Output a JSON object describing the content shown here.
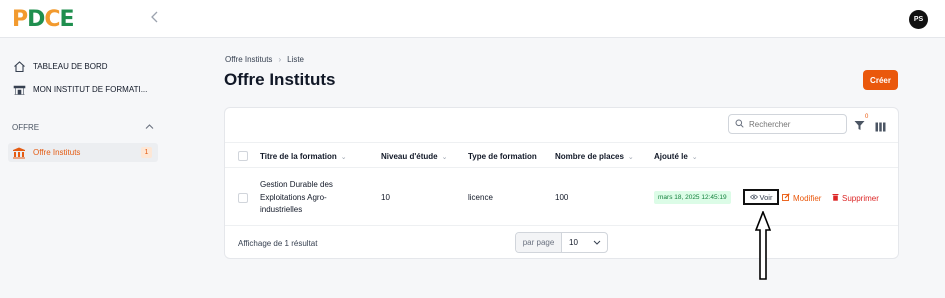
{
  "header": {
    "logo": [
      "P",
      "D",
      "C",
      "E"
    ],
    "collapse_icon": "chevron-left-icon",
    "avatar_initials": "PS"
  },
  "sidebar": {
    "items": [
      {
        "label": "TABLEAU DE BORD",
        "icon": "home-icon"
      },
      {
        "label": "MON INSTITUT DE FORMATI...",
        "icon": "building-icon"
      }
    ],
    "section_label": "OFFRE",
    "active_item": {
      "label": "Offre Instituts",
      "count": "1",
      "icon": "institution-icon"
    }
  },
  "breadcrumb": {
    "items": [
      "Offre Instituts",
      "Liste"
    ]
  },
  "page": {
    "title": "Offre Instituts",
    "create_label": "Créer"
  },
  "toolbar": {
    "search_placeholder": "Rechercher",
    "filter_count": "0"
  },
  "table": {
    "columns": [
      "Titre de la formation",
      "Niveau d'étude",
      "Type de formation",
      "Nombre de places",
      "Ajouté le"
    ],
    "rows": [
      {
        "title_lines": [
          "Gestion Durable des",
          "Exploitations Agro-",
          "industrielles"
        ],
        "niveau": "10",
        "type": "licence",
        "places": "100",
        "date": "mars 18, 2025 12:45:19",
        "actions": {
          "view": "Voir",
          "edit": "Modifier",
          "delete": "Supprimer"
        }
      }
    ],
    "footer_text": "Affichage de 1 résultat",
    "per_page_label": "par page",
    "per_page_value": "10"
  },
  "colors": {
    "accent": "#ea580c",
    "brand_orange": "#f29a2e",
    "brand_green": "#1f8f4e",
    "success_bg": "#dcfce7",
    "danger": "#dc2626"
  }
}
